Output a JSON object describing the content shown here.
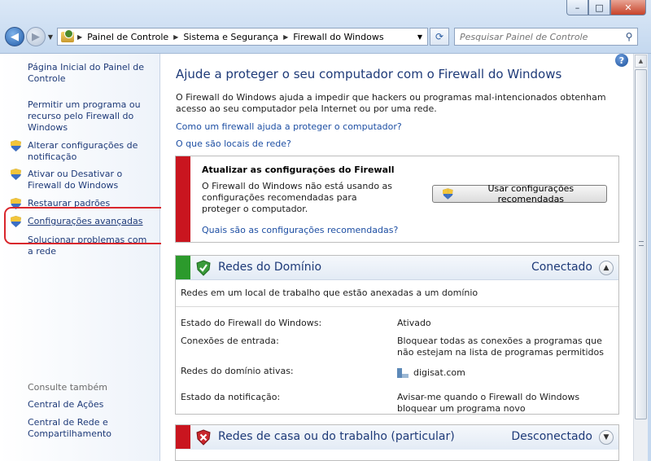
{
  "window": {
    "min_label": "–",
    "max_label": "□",
    "close_label": "✕"
  },
  "address": {
    "crumbs": [
      "Painel de Controle",
      "Sistema e Segurança",
      "Firewall do Windows"
    ],
    "search_placeholder": "Pesquisar Painel de Controle"
  },
  "sidebar": {
    "items": [
      {
        "label": "Página Inicial do Painel de Controle",
        "shield": false
      },
      {
        "label": "Permitir um programa ou recurso pelo Firewall do Windows",
        "shield": false
      },
      {
        "label": "Alterar configurações de notificação",
        "shield": true
      },
      {
        "label": "Ativar ou Desativar o Firewall do Windows",
        "shield": true
      },
      {
        "label": "Restaurar padrões",
        "shield": true
      },
      {
        "label": "Configurações avançadas",
        "shield": true
      },
      {
        "label": "Solucionar problemas com a rede",
        "shield": false
      }
    ],
    "see_also_title": "Consulte também",
    "see_also": [
      "Central de Ações",
      "Central de Rede e Compartilhamento"
    ]
  },
  "main": {
    "title": "Ajude a proteger o seu computador com o Firewall do Windows",
    "description": "O Firewall do Windows ajuda a impedir que hackers ou programas mal-intencionados obtenham acesso ao seu computador pela Internet ou por uma rede.",
    "link1": "Como um firewall ajuda a proteger o computador?",
    "link2": "O que são locais de rede?",
    "update_panel": {
      "title": "Atualizar as configurações do Firewall",
      "text": "O Firewall do Windows não está usando as configurações recomendadas para proteger o computador.",
      "button": "Usar configurações recomendadas",
      "link": "Quais são as configurações recomendadas?"
    },
    "domain_panel": {
      "title": "Redes do Domínio",
      "status": "Conectado",
      "description": "Redes em um local de trabalho que estão anexadas a um domínio",
      "rows": [
        {
          "key": "Estado do Firewall do Windows:",
          "value": "Ativado"
        },
        {
          "key": "Conexões de entrada:",
          "value": "Bloquear todas as conexões a programas que não estejam na lista de programas permitidos"
        },
        {
          "key": "Redes do domínio ativas:",
          "value": "digisat.com"
        },
        {
          "key": "Estado da notificação:",
          "value": "Avisar-me quando o Firewall do Windows bloquear um programa novo"
        }
      ]
    },
    "home_panel": {
      "title": "Redes de casa ou do trabalho (particular)",
      "status": "Desconectado"
    }
  },
  "colors": {
    "link": "#1e4fa3",
    "heading": "#1e3a78",
    "alert_red": "#c9151f",
    "ok_green": "#2c9a2c",
    "highlight": "#d9262c"
  }
}
